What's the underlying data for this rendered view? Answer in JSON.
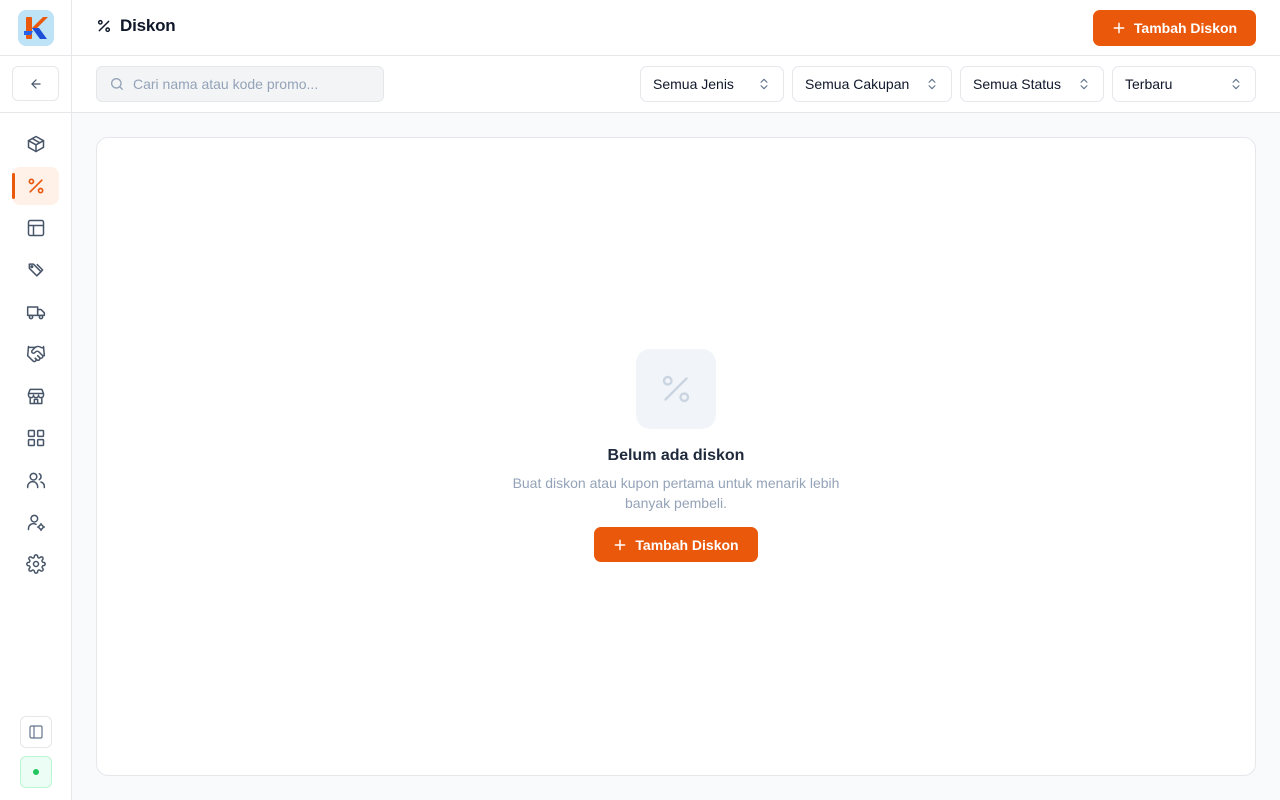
{
  "header": {
    "title": "Diskon",
    "add_button_label": "Tambah Diskon"
  },
  "toolbar": {
    "search_placeholder": "Cari nama atau kode promo...",
    "search_value": "",
    "filters": [
      {
        "label": "Semua Jenis"
      },
      {
        "label": "Semua Cakupan"
      },
      {
        "label": "Semua Status"
      },
      {
        "label": "Terbaru"
      }
    ]
  },
  "sidebar": {
    "items": [
      {
        "icon": "package-icon",
        "active": false
      },
      {
        "icon": "percent-icon",
        "active": true
      },
      {
        "icon": "layout-icon",
        "active": false
      },
      {
        "icon": "tags-icon",
        "active": false
      },
      {
        "icon": "truck-icon",
        "active": false
      },
      {
        "icon": "handshake-icon",
        "active": false
      },
      {
        "icon": "store-icon",
        "active": false
      },
      {
        "icon": "grid-icon",
        "active": false
      },
      {
        "icon": "users-icon",
        "active": false
      },
      {
        "icon": "user-cog-icon",
        "active": false
      },
      {
        "icon": "settings-icon",
        "active": false
      }
    ]
  },
  "empty_state": {
    "title": "Belum ada diskon",
    "description": "Buat diskon atau kupon pertama untuk menarik lebih banyak pembeli.",
    "button_label": "Tambah Diskon"
  },
  "colors": {
    "accent": "#ea580c",
    "active_bg": "#fff1e8",
    "status": "#22c55e"
  }
}
